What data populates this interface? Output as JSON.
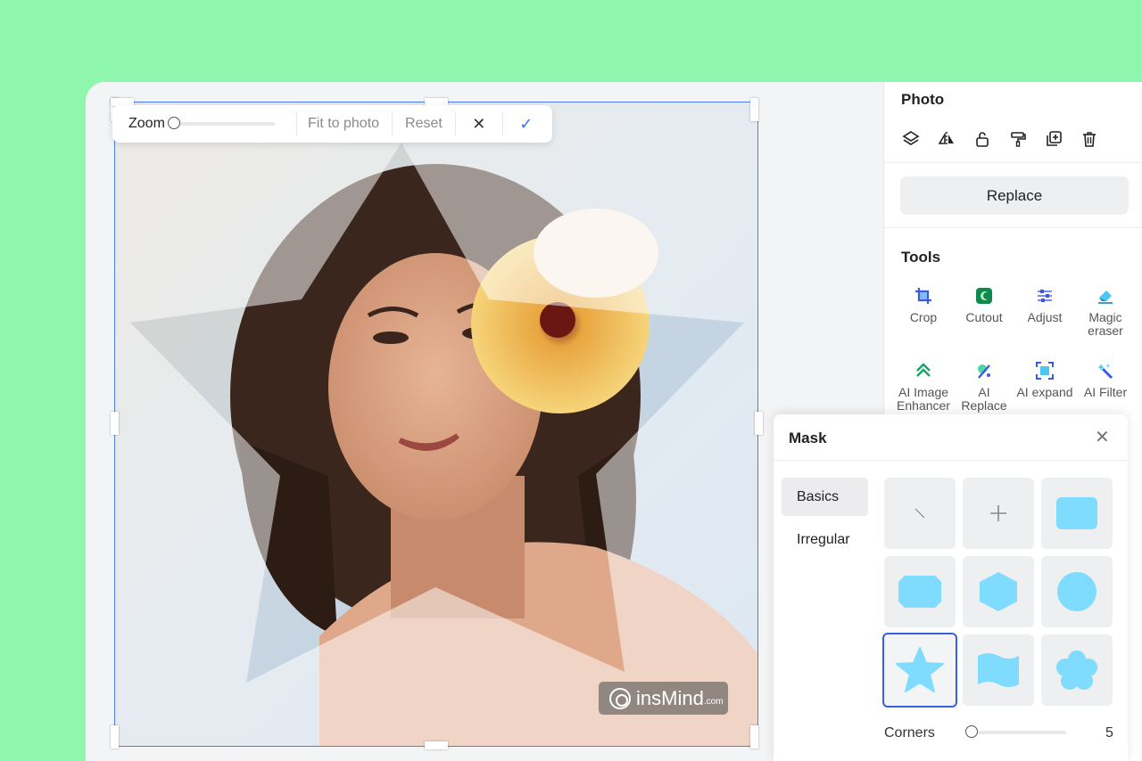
{
  "zoombar": {
    "zoom_label": "Zoom",
    "zoom_value": 0,
    "fit_label": "Fit to photo",
    "reset_label": "Reset",
    "cancel_symbol": "✕",
    "confirm_symbol": "✓"
  },
  "watermark": {
    "brand": "insMind",
    "suffix": ".com"
  },
  "photo_panel": {
    "title": "Photo",
    "icons": [
      "layers-icon",
      "flip-icon",
      "lock-icon",
      "paint-roller-icon",
      "duplicate-icon",
      "trash-icon"
    ],
    "replace_label": "Replace"
  },
  "tools": {
    "title": "Tools",
    "items": [
      {
        "label": "Crop",
        "icon": "crop-icon"
      },
      {
        "label": "Cutout",
        "icon": "cutout-icon"
      },
      {
        "label": "Adjust",
        "icon": "adjust-icon"
      },
      {
        "label": "Magic eraser",
        "icon": "magic-eraser-icon"
      },
      {
        "label": "AI Image Enhancer",
        "icon": "enhancer-icon"
      },
      {
        "label": "AI Replace",
        "icon": "ai-replace-icon"
      },
      {
        "label": "AI expand",
        "icon": "ai-expand-icon"
      },
      {
        "label": "AI Filter",
        "icon": "ai-filter-icon"
      }
    ]
  },
  "mask": {
    "title": "Mask",
    "close_symbol": "✕",
    "categories": [
      "Basics",
      "Irregular"
    ],
    "active_category": "Basics",
    "shapes": [
      "none",
      "add",
      "rounded-rectangle",
      "octagon",
      "hexagon",
      "circle",
      "star",
      "wave",
      "flower"
    ],
    "selected_shape": "star",
    "corners_label": "Corners",
    "corners_value": "5"
  },
  "colors": {
    "accent": "#3b6ef0",
    "shape_fill": "#7fdcff",
    "background": "#8ef7ad"
  }
}
